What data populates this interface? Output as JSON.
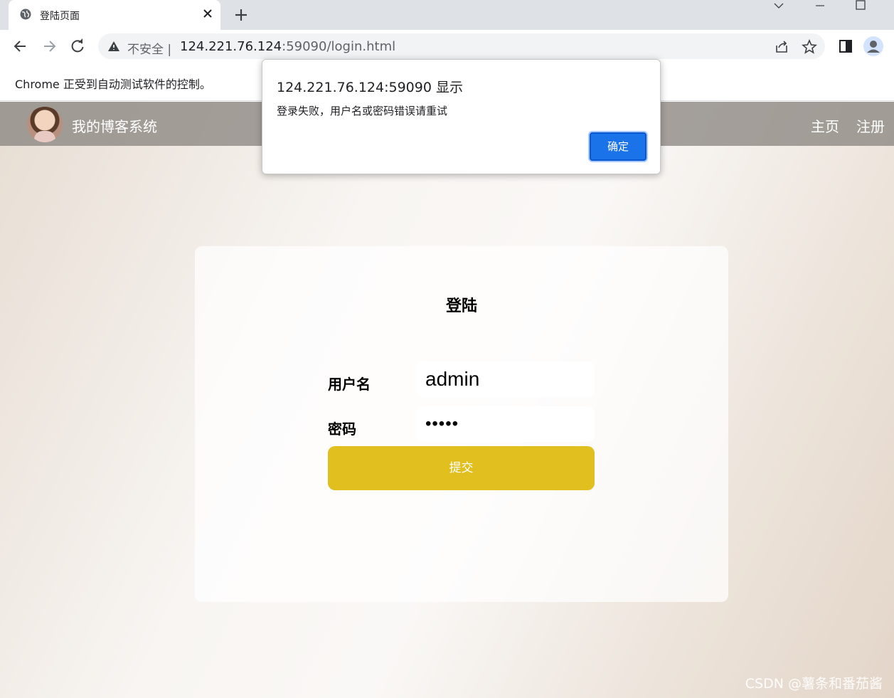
{
  "browser": {
    "tab": {
      "title": "登陆页面"
    },
    "address_bar": {
      "security_label": "不安全",
      "url_host": "124.221.76.124",
      "url_rest": ":59090/login.html"
    },
    "infobar": {
      "text": "Chrome 正受到自动测试软件的控制。"
    }
  },
  "page": {
    "navbar": {
      "site_title": "我的博客系统",
      "links": [
        "主页",
        "注册"
      ]
    },
    "login_card": {
      "title": "登陆",
      "username": {
        "label": "用户名",
        "value": "admin"
      },
      "password": {
        "label": "密码",
        "value": "•••••"
      },
      "submit_label": "提交"
    },
    "watermark": "CSDN @薯条和番茄酱"
  },
  "alert": {
    "title": "124.221.76.124:59090 显示",
    "message": "登录失败，用户名或密码错误请重试",
    "ok_label": "确定"
  },
  "colors": {
    "accent_button": "#e0bf1e",
    "dialog_button": "#1a73e8",
    "navbar": "#8c8782"
  },
  "icons": [
    "globe-icon",
    "close-icon",
    "plus-icon",
    "chevron-down-icon",
    "minimize-icon",
    "maximize-icon",
    "back-icon",
    "forward-icon",
    "reload-icon",
    "warning-icon",
    "share-icon",
    "star-icon",
    "sidepanel-icon",
    "profile-icon"
  ]
}
